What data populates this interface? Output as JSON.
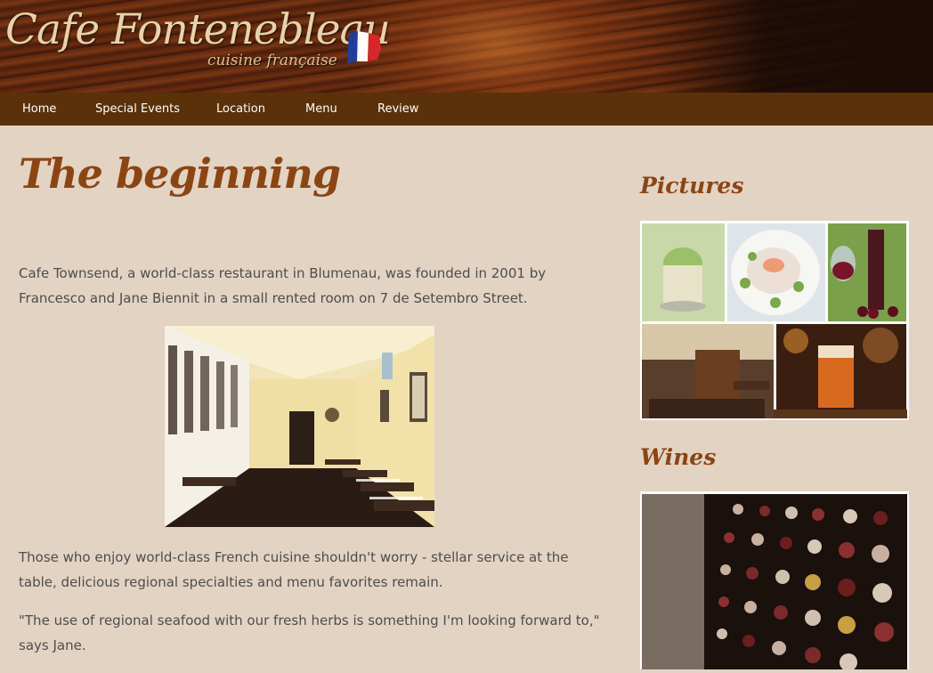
{
  "header": {
    "title": "Cafe Fontenebleau",
    "subtitle": "cuisine française"
  },
  "nav": {
    "items": [
      {
        "label": "Home"
      },
      {
        "label": "Special Events"
      },
      {
        "label": "Location"
      },
      {
        "label": "Menu"
      },
      {
        "label": "Review"
      }
    ]
  },
  "main": {
    "heading": "The beginning",
    "paragraphs": [
      "Cafe Townsend, a world-class restaurant in Blumenau, was founded in 2001 by Francesco and Jane Biennit in a small rented room on 7 de Setembro Street.",
      "Those who enjoy world-class French cuisine shouldn't worry - stellar service at the table, delicious regional specialties and menu favorites remain.",
      "\"The use of regional seafood with our fresh herbs is something I'm looking forward to,\" says Jane."
    ]
  },
  "sidebar": {
    "pictures_heading": "Pictures",
    "wines_heading": "Wines"
  },
  "colors": {
    "heading": "#8b4513",
    "nav_bg": "#5a3108",
    "page_bg": "#e3d3c3"
  }
}
